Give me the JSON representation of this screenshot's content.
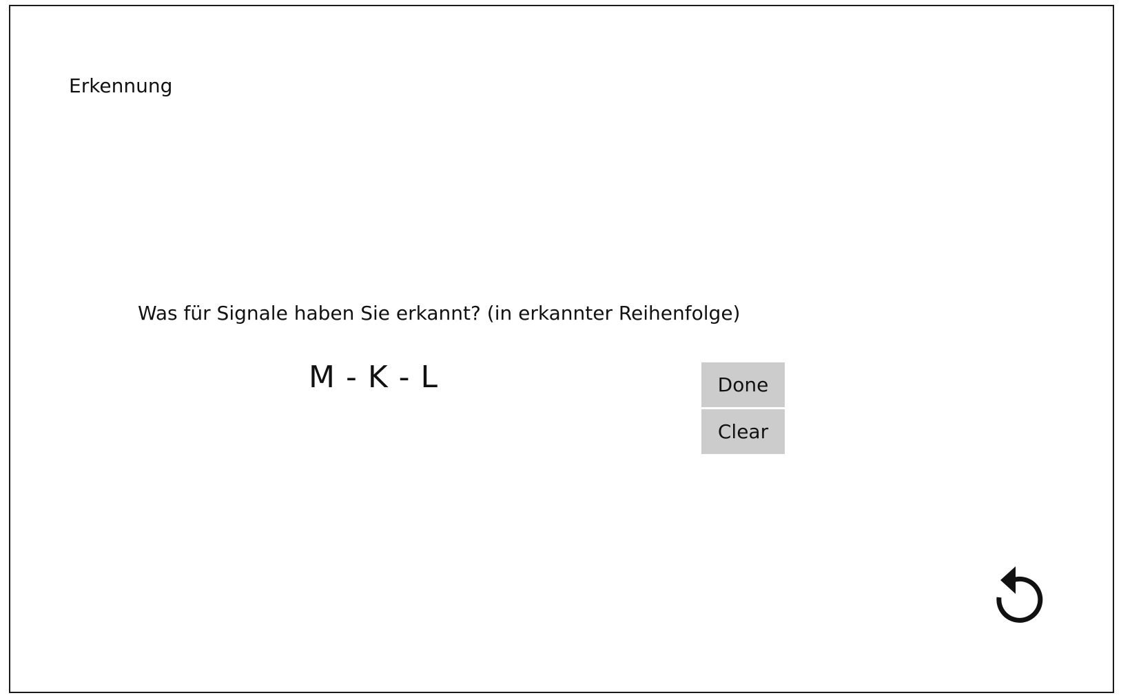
{
  "page": {
    "title": "Erkennung",
    "question": "Was für Signale haben Sie erkannt? (in erkannter Reihenfolge)",
    "answer": "M - K - L"
  },
  "buttons": {
    "done_label": "Done",
    "clear_label": "Clear"
  },
  "icons": {
    "reset": "reset-icon"
  },
  "colors": {
    "button_bg": "#cccccc",
    "frame_border": "#1a1a1a",
    "background": "#ffffff",
    "text": "#111111"
  }
}
